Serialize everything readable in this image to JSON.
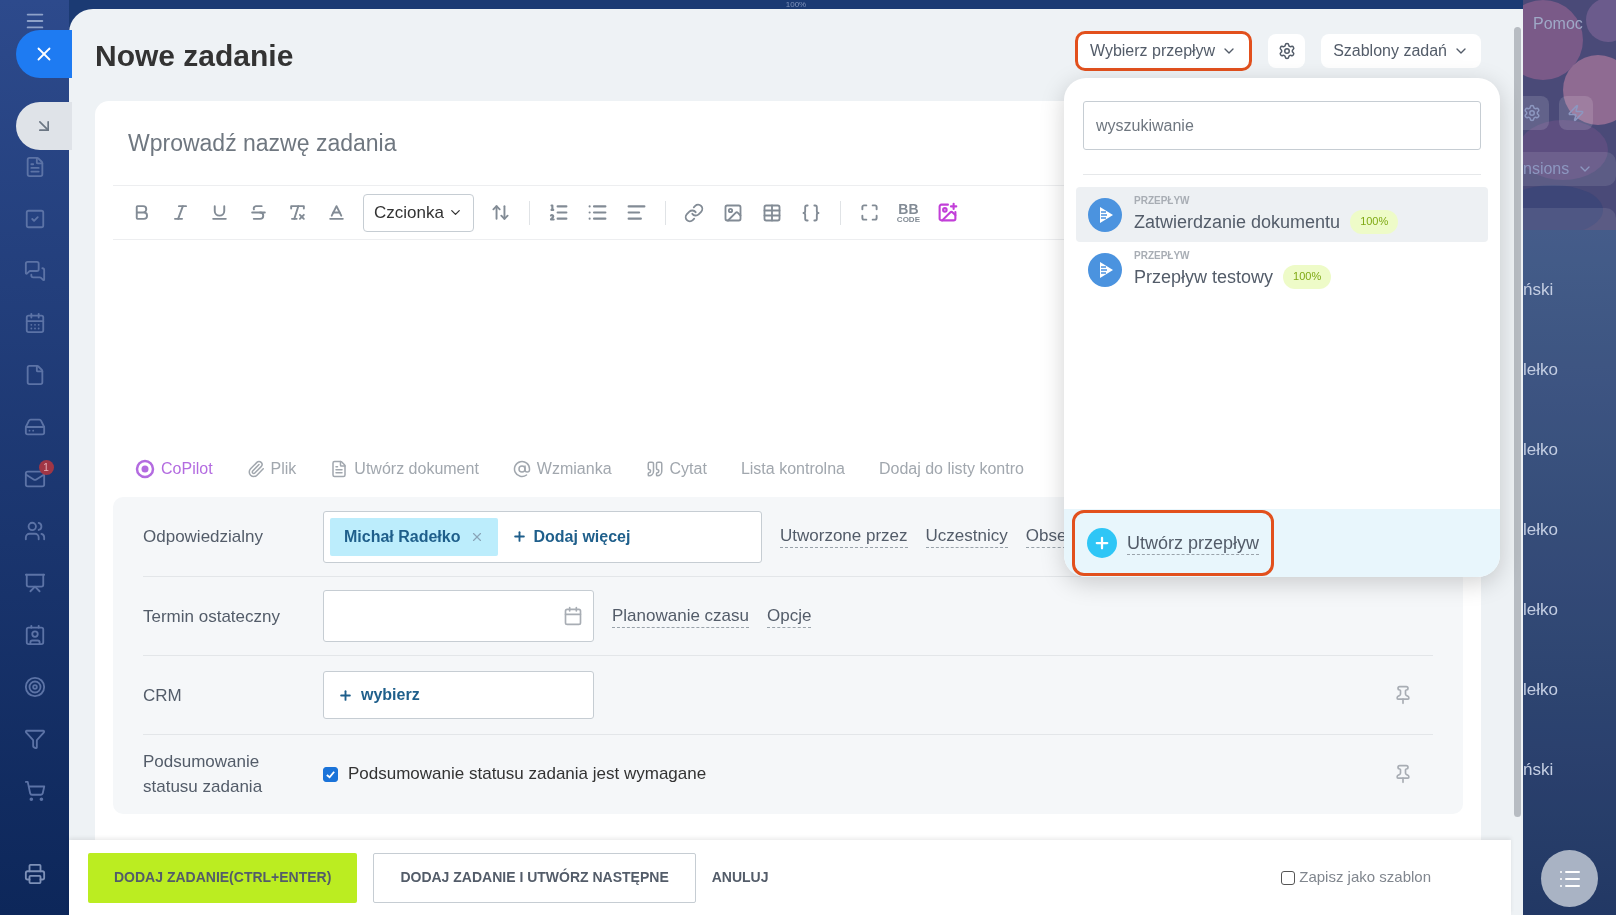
{
  "top_bar": {
    "zoom": "100%"
  },
  "sidebar": {
    "mail_badge": "1"
  },
  "header": {
    "title": "Nowe zadanie",
    "flow_button": "Wybierz przepływ",
    "templates_button": "Szablony zadań"
  },
  "task_name": {
    "placeholder": "Wprowadź nazwę zadania"
  },
  "toolbar": {
    "font_select": "Czcionka",
    "bbcode_top": "BB",
    "bbcode_bottom": "CODE"
  },
  "actions": [
    {
      "kind": "copilot",
      "label": "CoPilot"
    },
    {
      "kind": "file",
      "label": "Plik"
    },
    {
      "kind": "document",
      "label": "Utwórz dokument"
    },
    {
      "kind": "mention",
      "label": "Wzmianka"
    },
    {
      "kind": "quote",
      "label": "Cytat"
    },
    {
      "kind": "checklist",
      "label": "Lista kontrolna"
    },
    {
      "kind": "checklist",
      "label": "Dodaj do listy kontro"
    }
  ],
  "fields": [
    {
      "kind": "people",
      "label": "Odpowiedzialny",
      "chips": [
        "Michał Radełko"
      ],
      "add_label": "Dodaj więcej",
      "links": [
        "Utworzone przez",
        "Uczestnicy",
        "Obse"
      ]
    },
    {
      "kind": "date",
      "label": "Termin ostateczny",
      "links": [
        "Planowanie czasu",
        "Opcje"
      ]
    },
    {
      "kind": "crm",
      "label": "CRM",
      "add_label": "wybierz"
    },
    {
      "kind": "check",
      "label": "Podsumowanie statusu zadania",
      "checked": true,
      "text": "Podsumowanie statusu zadania jest wymagane"
    }
  ],
  "footer": {
    "primary": "DODAJ ZADANIE(CTRL+ENTER)",
    "secondary": "DODAJ ZADANIE I UTWÓRZ NASTĘPNE",
    "cancel": "ANULUJ",
    "template": {
      "label": "Zapisz jako szablon",
      "checked": false
    }
  },
  "flow_dropdown": {
    "search_placeholder": "wyszukiwanie",
    "items": [
      {
        "type_label": "PRZEPŁYW",
        "name": "Zatwierdzanie dokumentu",
        "badge": "100%",
        "selected": true
      },
      {
        "type_label": "PRZEPŁYW",
        "name": "Przepływ testowy",
        "badge": "100%",
        "selected": false
      }
    ],
    "create_label": "Utwórz przepływ"
  },
  "background": {
    "help": "Pomoc",
    "filter_label": "nsions",
    "list": [
      "ński",
      "lełko",
      "lełko",
      "lełko",
      "lełko",
      "lełko",
      "ński"
    ]
  }
}
